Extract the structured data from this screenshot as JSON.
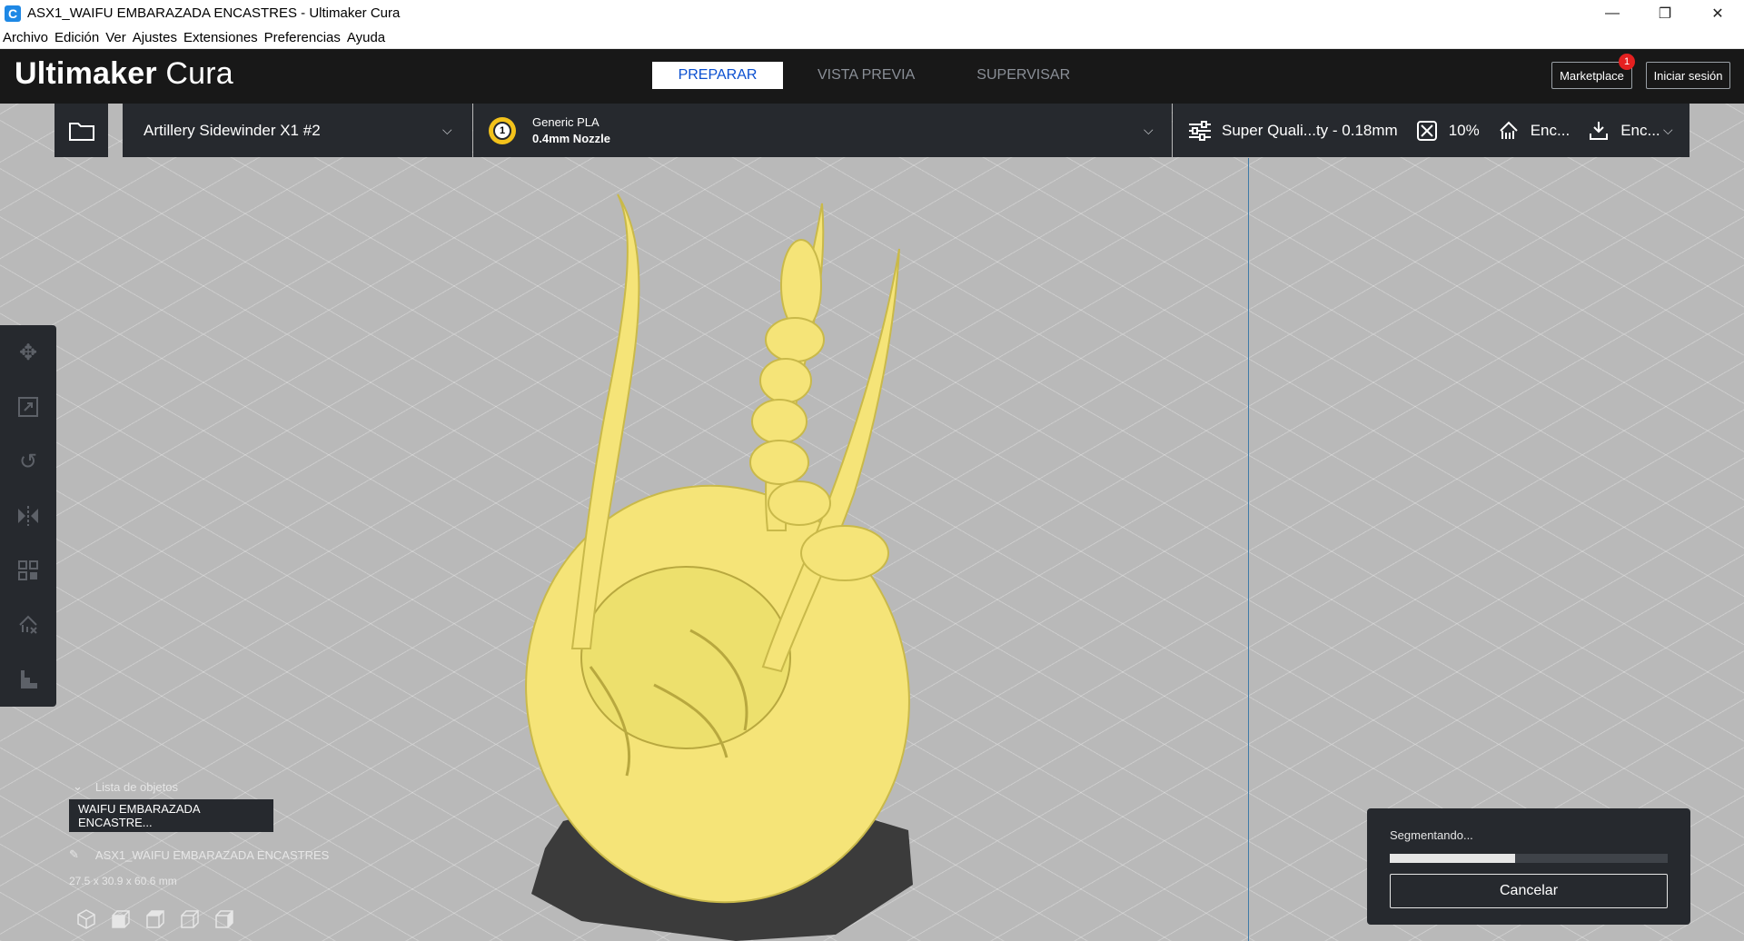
{
  "window": {
    "title": "ASX1_WAIFU EMBARAZADA ENCASTRES - Ultimaker Cura",
    "app_icon": "C",
    "minimize": "—",
    "maximize": "❐",
    "close": "✕"
  },
  "menu": [
    "Archivo",
    "Edición",
    "Ver",
    "Ajustes",
    "Extensiones",
    "Preferencias",
    "Ayuda"
  ],
  "header": {
    "brand_bold": "Ultimaker",
    "brand_light": "Cura",
    "tabs": [
      "PREPARAR",
      "VISTA PREVIA",
      "SUPERVISAR"
    ],
    "active_tab": "PREPARAR",
    "marketplace": "Marketplace",
    "marketplace_badge": "1",
    "signin": "Iniciar sesión"
  },
  "printer_bar": {
    "printer": "Artillery Sidewinder X1 #2",
    "material": "Generic PLA",
    "nozzle": "0.4mm Nozzle",
    "extruder_number": "1",
    "profile": "Super Quali...ty - 0.18mm",
    "infill": "10%",
    "support": "Enc...",
    "adhesion": "Enc..."
  },
  "object_list": {
    "header": "Lista de objetos",
    "selected_item": "WAIFU EMBARAZADA ENCASTRE...",
    "file_name": "ASX1_WAIFU EMBARAZADA ENCASTRES",
    "dimensions": "27.5 x 30.9 x 60.6 mm"
  },
  "slicing": {
    "status": "Segmentando...",
    "progress": 0.45,
    "cancel": "Cancelar"
  },
  "colors": {
    "model": "#f5e478",
    "accent": "#0a4fd0",
    "panel": "#26292e",
    "header": "#181818"
  }
}
